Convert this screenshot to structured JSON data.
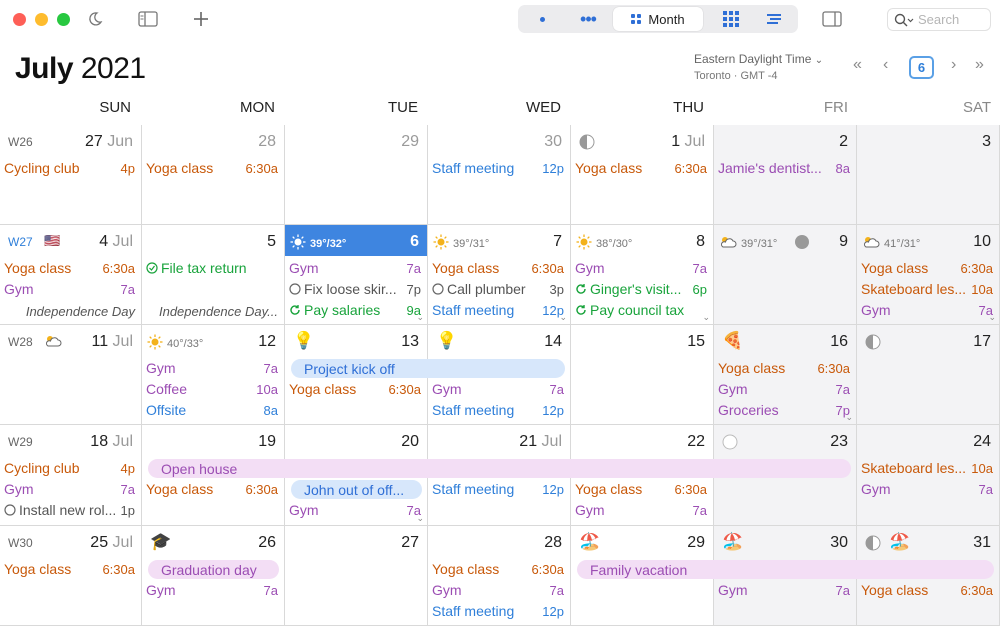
{
  "window": {
    "controls": [
      "close",
      "minimize",
      "zoom"
    ],
    "views": [
      {
        "label": "",
        "icon": "day-dot-icon"
      },
      {
        "label": "",
        "icon": "week-dots-icon"
      },
      {
        "label": "Month",
        "icon": "month-grid-icon",
        "active": true
      },
      {
        "label": "",
        "icon": "year-grid-icon"
      },
      {
        "label": "",
        "icon": "list-view-icon"
      }
    ],
    "search_placeholder": "Search"
  },
  "header": {
    "month": "July",
    "year": "2021",
    "timezone": "Eastern Daylight Time",
    "timezone_sub": "Toronto · GMT -4",
    "today_number": "6"
  },
  "weekdays": [
    "SUN",
    "MON",
    "TUE",
    "WED",
    "THU",
    "FRI",
    "SAT"
  ],
  "weeks": [
    {
      "label": "W26",
      "days": [
        {
          "num": "27",
          "mo": "Jun",
          "events": [
            {
              "n": "Cycling club",
              "t": "4p",
              "c": "orange"
            }
          ]
        },
        {
          "num": "28",
          "faded": true,
          "events": [
            {
              "n": "Yoga class",
              "t": "6:30a",
              "c": "orange"
            }
          ]
        },
        {
          "num": "29",
          "faded": true,
          "events": []
        },
        {
          "num": "30",
          "faded": true,
          "events": [
            {
              "n": "Staff meeting",
              "t": "12p",
              "c": "blue"
            }
          ]
        },
        {
          "num": "1",
          "mo": "Jul",
          "moon": "half",
          "events": [
            {
              "n": "Yoga class",
              "t": "6:30a",
              "c": "orange"
            }
          ]
        },
        {
          "num": "2",
          "gray": true,
          "events": [
            {
              "n": "Jamie's dentist...",
              "t": "8a",
              "c": "purple"
            }
          ]
        },
        {
          "num": "3",
          "gray": true,
          "events": []
        }
      ]
    },
    {
      "label": "W27",
      "flag": "🇺🇸",
      "current": true,
      "days": [
        {
          "num": "4",
          "mo": "Jul",
          "events": [
            {
              "n": "Yoga class",
              "t": "6:30a",
              "c": "orange"
            },
            {
              "n": "Gym",
              "t": "7a",
              "c": "purple"
            }
          ],
          "holiday": "Independence Day"
        },
        {
          "num": "5",
          "events": [
            {
              "n": "File tax return",
              "t": "",
              "c": "green",
              "task": "done"
            }
          ],
          "holiday": "Independence Day..."
        },
        {
          "num": "6",
          "today": true,
          "weather": "39°/32°",
          "events": [
            {
              "n": "Gym",
              "t": "7a",
              "c": "purple"
            },
            {
              "n": "Fix loose skir...",
              "t": "7p",
              "c": "gray",
              "task": "open"
            },
            {
              "n": "Pay salaries",
              "t": "9a",
              "c": "green",
              "task": "repeat"
            }
          ],
          "more": true
        },
        {
          "num": "7",
          "weather": "39°/31°",
          "events": [
            {
              "n": "Yoga class",
              "t": "6:30a",
              "c": "orange"
            },
            {
              "n": "Call plumber",
              "t": "3p",
              "c": "gray",
              "task": "open"
            },
            {
              "n": "Staff meeting",
              "t": "12p",
              "c": "blue"
            }
          ],
          "more": true
        },
        {
          "num": "8",
          "weather": "38°/30°",
          "events": [
            {
              "n": "Gym",
              "t": "7a",
              "c": "purple"
            },
            {
              "n": "Ginger's visit...",
              "t": "6p",
              "c": "green",
              "task": "repeat"
            },
            {
              "n": "Pay council tax",
              "t": "",
              "c": "green",
              "task": "repeat"
            }
          ],
          "more": true
        },
        {
          "num": "9",
          "gray": true,
          "weather": "39°/31°",
          "moon": "full",
          "events": []
        },
        {
          "num": "10",
          "gray": true,
          "weather": "41°/31°",
          "events": [
            {
              "n": "Yoga class",
              "t": "6:30a",
              "c": "orange"
            },
            {
              "n": "Skateboard les...",
              "t": "10a",
              "c": "orange"
            },
            {
              "n": "Gym",
              "t": "7a",
              "c": "purple"
            }
          ],
          "more": true
        }
      ]
    },
    {
      "label": "W28",
      "days": [
        {
          "num": "11",
          "mo": "Jul",
          "events": []
        },
        {
          "num": "12",
          "weather": "40°/33°",
          "events": [
            {
              "n": "Gym",
              "t": "7a",
              "c": "purple"
            },
            {
              "n": "Coffee",
              "t": "10a",
              "c": "purple"
            },
            {
              "n": "Offsite",
              "t": "8a",
              "c": "blue"
            }
          ]
        },
        {
          "num": "13",
          "emoji": "💡",
          "events": [
            {
              "n": "Yoga class",
              "t": "6:30a",
              "c": "orange"
            }
          ]
        },
        {
          "num": "14",
          "emoji": "💡",
          "events": [
            {
              "n": "Gym",
              "t": "7a",
              "c": "purple"
            },
            {
              "n": "Staff meeting",
              "t": "12p",
              "c": "blue"
            }
          ]
        },
        {
          "num": "15",
          "events": []
        },
        {
          "num": "16",
          "gray": true,
          "emoji": "🍕",
          "events": [
            {
              "n": "Yoga class",
              "t": "6:30a",
              "c": "orange"
            },
            {
              "n": "Gym",
              "t": "7a",
              "c": "purple"
            },
            {
              "n": "Groceries",
              "t": "7p",
              "c": "purple"
            }
          ],
          "more": true
        },
        {
          "num": "17",
          "gray": true,
          "moon": "half",
          "events": []
        }
      ]
    },
    {
      "label": "W29",
      "days": [
        {
          "num": "18",
          "mo": "Jul",
          "events": [
            {
              "n": "Cycling club",
              "t": "4p",
              "c": "orange"
            },
            {
              "n": "Gym",
              "t": "7a",
              "c": "purple"
            },
            {
              "n": "Install new rol...",
              "t": "1p",
              "c": "gray",
              "task": "open"
            }
          ]
        },
        {
          "num": "19",
          "events": [
            {
              "n": "Yoga class",
              "t": "6:30a",
              "c": "orange"
            }
          ]
        },
        {
          "num": "20",
          "events": [
            {
              "n": "Gym",
              "t": "7a",
              "c": "purple"
            }
          ],
          "more": true
        },
        {
          "num": "21",
          "mo": "Jul",
          "events": [
            {
              "n": "Staff meeting",
              "t": "12p",
              "c": "blue"
            }
          ]
        },
        {
          "num": "22",
          "events": [
            {
              "n": "Yoga class",
              "t": "6:30a",
              "c": "orange"
            },
            {
              "n": "Gym",
              "t": "7a",
              "c": "purple"
            }
          ]
        },
        {
          "num": "23",
          "gray": true,
          "moon": "new",
          "events": []
        },
        {
          "num": "24",
          "gray": true,
          "events": [
            {
              "n": "Skateboard les...",
              "t": "10a",
              "c": "orange"
            },
            {
              "n": "Gym",
              "t": "7a",
              "c": "purple"
            }
          ]
        }
      ]
    },
    {
      "label": "W30",
      "days": [
        {
          "num": "25",
          "mo": "Jul",
          "events": [
            {
              "n": "Yoga class",
              "t": "6:30a",
              "c": "orange"
            }
          ]
        },
        {
          "num": "26",
          "emoji": "🎓",
          "events": [
            {
              "n": "Gym",
              "t": "7a",
              "c": "purple"
            }
          ]
        },
        {
          "num": "27",
          "events": []
        },
        {
          "num": "28",
          "events": [
            {
              "n": "Yoga class",
              "t": "6:30a",
              "c": "orange"
            },
            {
              "n": "Gym",
              "t": "7a",
              "c": "purple"
            },
            {
              "n": "Staff meeting",
              "t": "12p",
              "c": "blue"
            }
          ]
        },
        {
          "num": "29",
          "emoji": "🏖️",
          "events": []
        },
        {
          "num": "30",
          "gray": true,
          "emoji": "🏖️",
          "events": [
            {
              "n": "Gym",
              "t": "7a",
              "c": "purple"
            }
          ]
        },
        {
          "num": "31",
          "gray": true,
          "emoji": "🏖️",
          "moon": "half",
          "events": [
            {
              "n": "Yoga class",
              "t": "6:30a",
              "c": "orange"
            }
          ]
        }
      ]
    }
  ],
  "bars": [
    {
      "label": "Project kick off",
      "color": "blue",
      "week": 2,
      "from": 2,
      "to": 3,
      "row": 1
    },
    {
      "label": "Open house",
      "color": "pink",
      "week": 3,
      "from": 1,
      "to": 5,
      "row": 1
    },
    {
      "label": "John out of off...",
      "color": "blue",
      "week": 3,
      "from": 2,
      "to": 2,
      "row": 2
    },
    {
      "label": "Graduation day",
      "color": "pink",
      "week": 4,
      "from": 1,
      "to": 1,
      "row": 1
    },
    {
      "label": "Family vacation",
      "color": "pink",
      "week": 4,
      "from": 4,
      "to": 6,
      "row": 1
    }
  ]
}
